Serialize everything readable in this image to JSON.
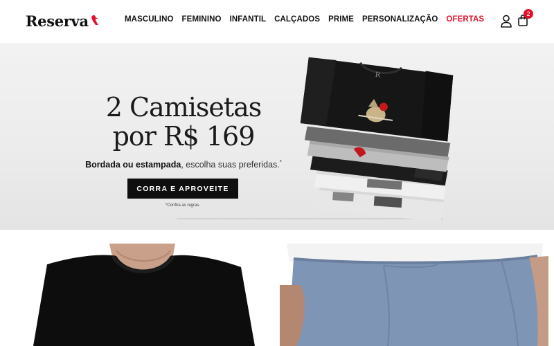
{
  "header": {
    "logo_text": "Reserva",
    "nav": [
      {
        "label": "MASCULINO"
      },
      {
        "label": "FEMININO"
      },
      {
        "label": "INFANTIL"
      },
      {
        "label": "CALÇADOS"
      },
      {
        "label": "PRIME"
      },
      {
        "label": "PERSONALIZAÇÃO"
      },
      {
        "label": "OFERTAS",
        "color": "#e3102a"
      }
    ],
    "cart_count": "2"
  },
  "hero": {
    "title_line1": "2 Camisetas",
    "title_line2": "por R$ 169",
    "subtitle_bold": "Bordada ou estampada",
    "subtitle_rest": ", escolha suas preferidas.",
    "subtitle_mark": "*",
    "cta_label": "CORRA E APROVEITE",
    "footnote": "*Confira as regras."
  },
  "colors": {
    "accent": "#e3102a",
    "button_bg": "#0f0f0f",
    "hero_bg": "#ececec"
  }
}
